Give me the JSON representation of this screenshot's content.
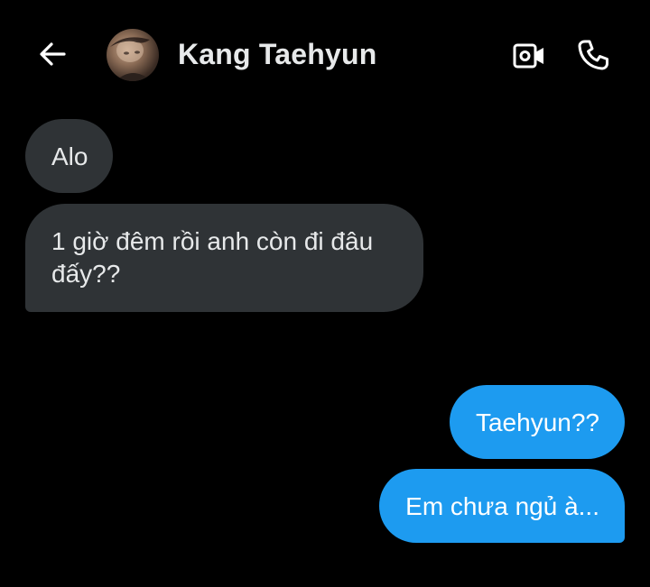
{
  "header": {
    "back_icon": "arrow-left-icon",
    "contact_name": "Kang Taehyun",
    "video_icon": "video-camera-icon",
    "call_icon": "phone-icon"
  },
  "messages": [
    {
      "direction": "incoming",
      "text": "Alo"
    },
    {
      "direction": "incoming",
      "text": "1 giờ đêm rồi anh còn đi đâu đấy??"
    },
    {
      "direction": "outgoing",
      "text": "Taehyun??"
    },
    {
      "direction": "outgoing",
      "text": "Em chưa ngủ à..."
    }
  ],
  "colors": {
    "background": "#000000",
    "incoming_bubble": "#2f3336",
    "outgoing_bubble": "#1d9bf0",
    "text": "#e7e9ea"
  }
}
